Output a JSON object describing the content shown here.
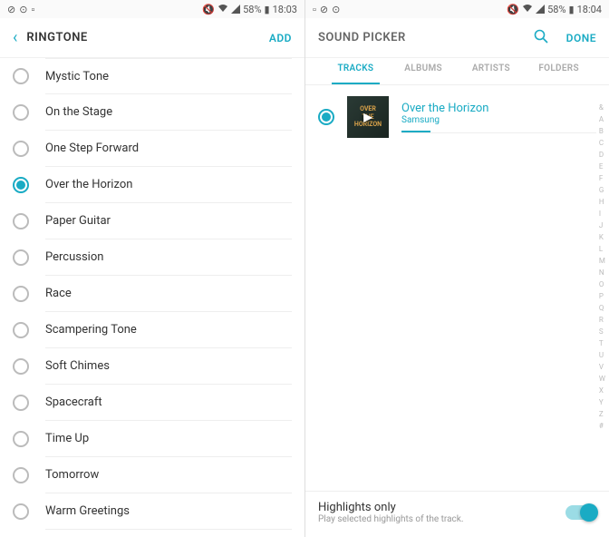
{
  "left": {
    "status": {
      "battery": "58%",
      "time": "18:03"
    },
    "header": {
      "title": "RINGTONE",
      "action": "ADD"
    },
    "items": [
      {
        "label": "Mystic Tone",
        "selected": false
      },
      {
        "label": "On the Stage",
        "selected": false
      },
      {
        "label": "One Step Forward",
        "selected": false
      },
      {
        "label": "Over the Horizon",
        "selected": true
      },
      {
        "label": "Paper Guitar",
        "selected": false
      },
      {
        "label": "Percussion",
        "selected": false
      },
      {
        "label": "Race",
        "selected": false
      },
      {
        "label": "Scampering Tone",
        "selected": false
      },
      {
        "label": "Soft Chimes",
        "selected": false
      },
      {
        "label": "Spacecraft",
        "selected": false
      },
      {
        "label": "Time Up",
        "selected": false
      },
      {
        "label": "Tomorrow",
        "selected": false
      },
      {
        "label": "Warm Greetings",
        "selected": false
      }
    ]
  },
  "right": {
    "status": {
      "battery": "58%",
      "time": "18:04"
    },
    "header": {
      "title": "SOUND PICKER",
      "action": "DONE"
    },
    "tabs": [
      "TRACKS",
      "ALBUMS",
      "ARTISTS",
      "FOLDERS"
    ],
    "active_tab": 0,
    "track": {
      "title": "Over the Horizon",
      "artist": "Samsung"
    },
    "index": [
      "&",
      "A",
      "B",
      "C",
      "D",
      "E",
      "F",
      "G",
      "H",
      "I",
      "J",
      "K",
      "L",
      "M",
      "N",
      "O",
      "P",
      "Q",
      "R",
      "S",
      "T",
      "U",
      "V",
      "W",
      "X",
      "Y",
      "Z",
      "#"
    ],
    "highlights": {
      "title": "Highlights only",
      "sub": "Play selected highlights of the track."
    }
  }
}
